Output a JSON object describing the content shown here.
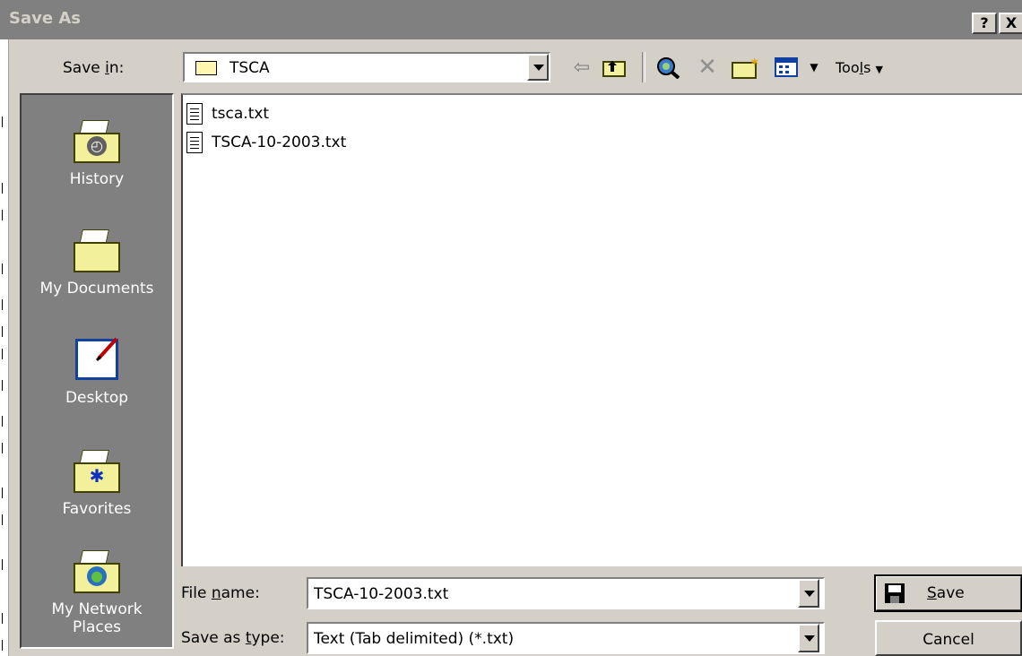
{
  "window": {
    "title": "Save As",
    "help_button": "?",
    "close_button": "X"
  },
  "toolbar": {
    "save_in_label_pre": "Save ",
    "save_in_label_u": "i",
    "save_in_label_post": "n:",
    "save_in_value": "TSCA",
    "tools_label_pre": "Too",
    "tools_label_u": "l",
    "tools_label_post": "s"
  },
  "places": [
    {
      "label": "History",
      "icon": "history-folder-icon"
    },
    {
      "label": "My Documents",
      "icon": "my-documents-folder-icon"
    },
    {
      "label": "Desktop",
      "icon": "desktop-icon"
    },
    {
      "label": "Favorites",
      "icon": "favorites-folder-icon"
    },
    {
      "label_line1": "My Network",
      "label_line2": "Places",
      "icon": "network-places-icon"
    }
  ],
  "files": [
    {
      "name": "tsca.txt"
    },
    {
      "name": "TSCA-10-2003.txt"
    }
  ],
  "form": {
    "file_name_label_pre": "File ",
    "file_name_label_u": "n",
    "file_name_label_post": "ame:",
    "file_name_value": "TSCA-10-2003.txt",
    "save_type_label_pre": "Save as ",
    "save_type_label_u": "t",
    "save_type_label_post": "ype:",
    "save_type_value": "Text (Tab delimited) (*.txt)",
    "save_button_u": "S",
    "save_button_rest": "ave",
    "cancel_button": "Cancel"
  }
}
